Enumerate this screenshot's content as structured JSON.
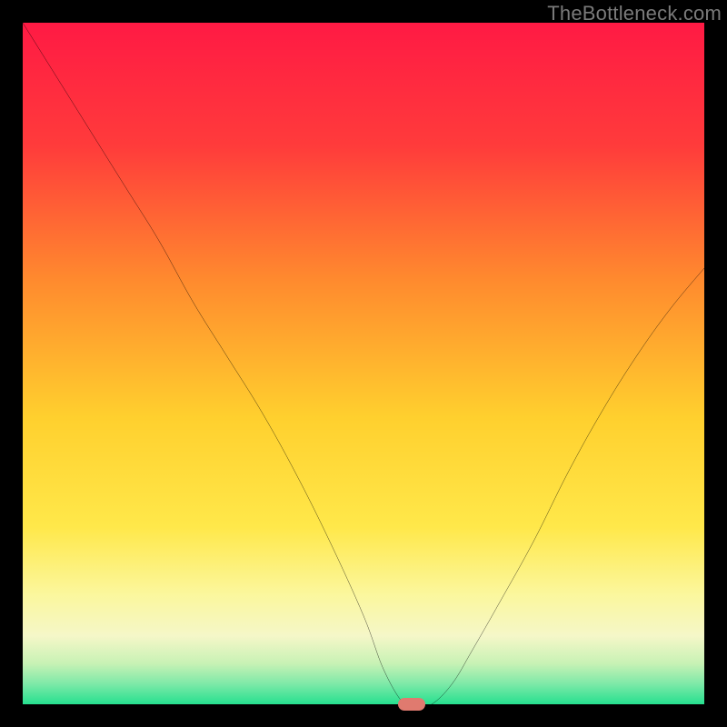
{
  "watermark": "TheBottleneck.com",
  "chart_data": {
    "type": "line",
    "title": "",
    "xlabel": "",
    "ylabel": "",
    "xlim": [
      0,
      100
    ],
    "ylim": [
      0,
      100
    ],
    "grid": false,
    "legend": false,
    "gradient_stops": [
      {
        "offset": 0,
        "color": "#ff1a44"
      },
      {
        "offset": 18,
        "color": "#ff3b3b"
      },
      {
        "offset": 38,
        "color": "#ff8b2e"
      },
      {
        "offset": 58,
        "color": "#ffd02e"
      },
      {
        "offset": 74,
        "color": "#ffe84a"
      },
      {
        "offset": 84,
        "color": "#fbf79e"
      },
      {
        "offset": 90,
        "color": "#f5f7c8"
      },
      {
        "offset": 94,
        "color": "#c8f2b5"
      },
      {
        "offset": 97,
        "color": "#7ee9a8"
      },
      {
        "offset": 100,
        "color": "#26e08f"
      }
    ],
    "series": [
      {
        "name": "bottleneck-curve",
        "color": "#000000",
        "x": [
          0,
          5,
          10,
          15,
          20,
          25,
          30,
          35,
          40,
          45,
          50,
          53,
          56,
          58,
          60,
          63,
          66,
          70,
          75,
          80,
          85,
          90,
          95,
          100
        ],
        "y": [
          100,
          92,
          84,
          76,
          68,
          59,
          51,
          43,
          34,
          24,
          13,
          5,
          0,
          0,
          0,
          3,
          8,
          15,
          24,
          34,
          43,
          51,
          58,
          64
        ]
      }
    ],
    "marker": {
      "x": 57,
      "y": 0,
      "color": "#e07a6f"
    }
  }
}
